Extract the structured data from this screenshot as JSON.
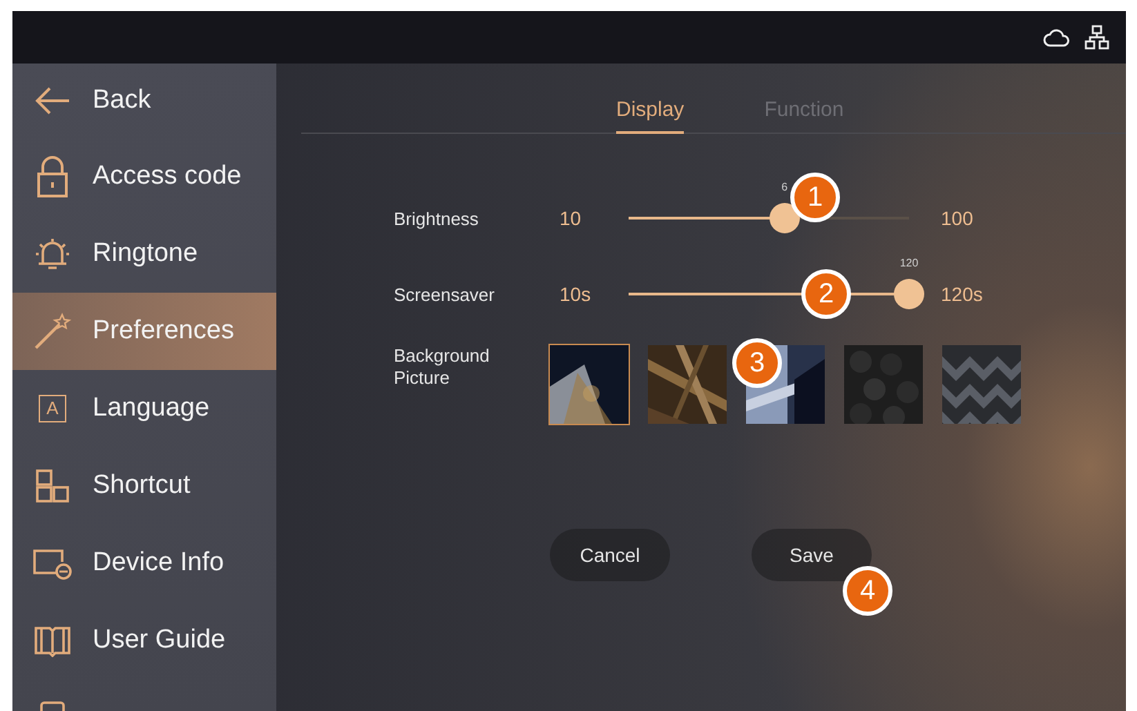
{
  "sidebar": {
    "items": [
      {
        "kind": "back",
        "label": "Back",
        "selected": false
      },
      {
        "kind": "lock",
        "label": "Access code",
        "selected": false
      },
      {
        "kind": "bell",
        "label": "Ringtone",
        "selected": false
      },
      {
        "kind": "wand",
        "label": "Preferences",
        "selected": true
      },
      {
        "kind": "glyph",
        "glyph": "A",
        "label": "Language",
        "selected": false
      },
      {
        "kind": "blocks",
        "label": "Shortcut",
        "selected": false
      },
      {
        "kind": "device",
        "label": "Device Info",
        "selected": false
      },
      {
        "kind": "book",
        "label": "User Guide",
        "selected": false
      },
      {
        "kind": "tablet",
        "selected": false
      }
    ]
  },
  "tabs": [
    {
      "label": "Display",
      "selected": true
    },
    {
      "label": "Function",
      "selected": false
    }
  ],
  "sliders": [
    {
      "label": "Brightness",
      "min": "10",
      "max": "100",
      "value_label": "6",
      "level": 0.556
    },
    {
      "label": "Screensaver",
      "min": "10s",
      "max": "120s",
      "value_label": "120",
      "level": 1.0
    }
  ],
  "background": {
    "label": "Background\nPicture",
    "options": [
      {
        "kind": "picture",
        "selected": true
      },
      {
        "kind": "picture",
        "selected": false
      },
      {
        "kind": "picture",
        "selected": false
      },
      {
        "kind": "picture",
        "selected": false
      },
      {
        "kind": "picture",
        "selected": false
      }
    ]
  },
  "buttons": [
    {
      "label": "Cancel"
    },
    {
      "label": "Save"
    }
  ],
  "callouts": [
    {
      "number": "1"
    },
    {
      "number": "2"
    },
    {
      "number": "3"
    },
    {
      "number": "4"
    }
  ]
}
